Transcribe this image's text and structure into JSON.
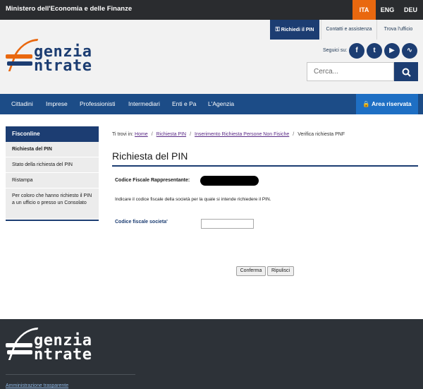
{
  "topbar": {
    "ministry": "Ministero dell'Economia e delle Finanze",
    "languages": [
      {
        "label": "ITA",
        "active": true
      },
      {
        "label": "ENG",
        "active": false
      },
      {
        "label": "DEU",
        "active": false
      }
    ]
  },
  "header": {
    "utility_links": {
      "pin": "Richiedi il PIN",
      "contatti": "Contatti e assistenza",
      "trova": "Trova l'ufficio"
    },
    "logo": {
      "line1": "genzia",
      "line2": "ntrate"
    },
    "social_label": "Seguici su:",
    "social": [
      "facebook-icon",
      "twitter-icon",
      "youtube-icon",
      "rss-icon"
    ],
    "search_placeholder": "Cerca..."
  },
  "nav": {
    "items": [
      "Cittadini",
      "Imprese",
      "Professionisti",
      "Intermediari",
      "Enti e Pa",
      "L'Agenzia"
    ],
    "area_riservata": "Area riservata"
  },
  "sidebar": {
    "title": "Fisconline",
    "items": [
      "Richiesta del PIN",
      "Stato della richiesta del PIN",
      "Ristampa",
      "Per coloro che hanno richiesto il PIN a un ufficio o presso un Consolato"
    ]
  },
  "breadcrumb": {
    "prefix": "Ti trovi in:",
    "links": [
      "Home",
      "Richiesta PIN",
      "Inserimento Richiesta Persone Non Fisiche"
    ],
    "current": "Verifica richiesta PNF"
  },
  "content": {
    "title": "Richiesta del PIN",
    "cf_rappresentante_label": "Codice Fiscale Rappresentante:",
    "instruction": "Indicare il codice fiscale della società per la quale si intende richiedere il PIN.",
    "cf_societa_label": "Codice fiscale societa'",
    "cf_societa_value": "",
    "confirm_label": "Conferma",
    "reset_label": "Ripulisci"
  },
  "footer": {
    "logo": {
      "line1": "genzia",
      "line2": "ntrate"
    },
    "link": "Amministrazione trasparente"
  },
  "colors": {
    "dark_bar": "#2a2c2f",
    "accent_orange": "#e9680f",
    "brand_blue": "#1c3d72",
    "nav_blue": "#1c4c87",
    "area_blue": "#1e6fc4",
    "footer_bg": "#2d3238"
  }
}
